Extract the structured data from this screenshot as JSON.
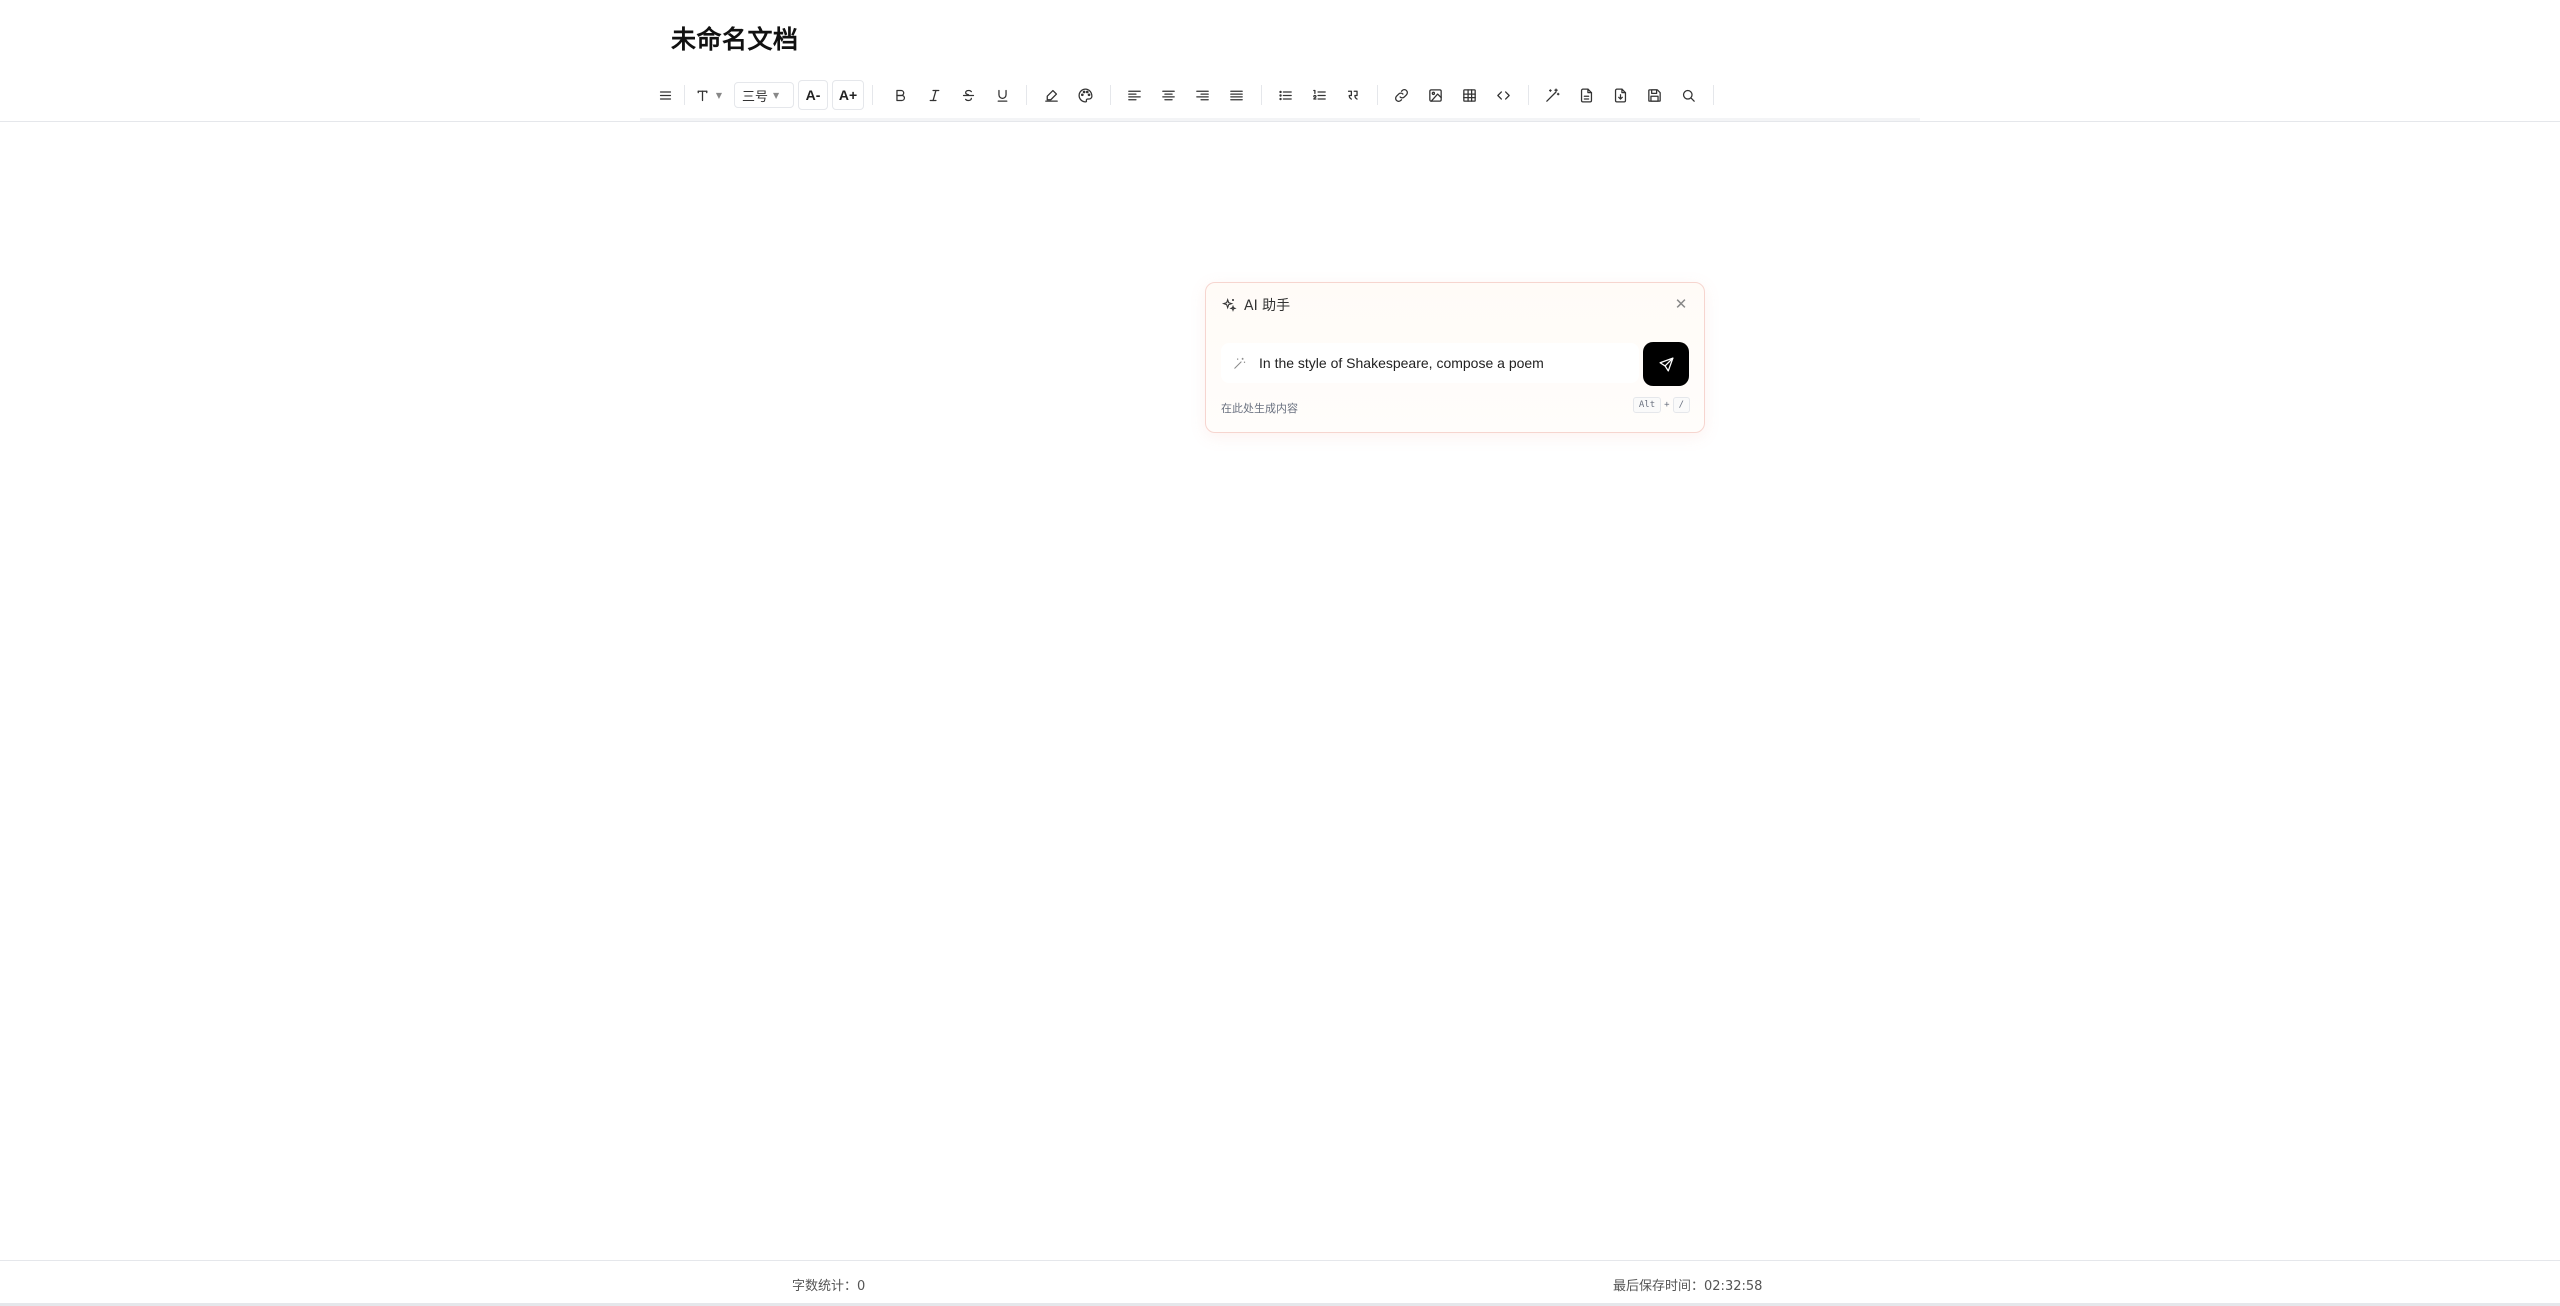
{
  "document": {
    "title": "未命名文档"
  },
  "toolbar": {
    "font_size_value": "三号",
    "decrease_font_label": "A-",
    "increase_font_label": "A+",
    "buttons": [
      "menu-icon",
      "text-style-icon",
      "font-size-select",
      "decrease-font-icon",
      "increase-font-icon",
      "bold-icon",
      "italic-icon",
      "strikethrough-icon",
      "underline-icon",
      "highlight-icon",
      "palette-icon",
      "align-left-icon",
      "align-center-icon",
      "align-right-icon",
      "align-justify-icon",
      "bullet-list-icon",
      "ordered-list-icon",
      "quote-icon",
      "link-icon",
      "image-icon",
      "table-icon",
      "code-icon",
      "ai-magic-icon",
      "file-icon",
      "export-file-icon",
      "save-icon",
      "search-icon"
    ]
  },
  "ai_panel": {
    "title": "AI 助手",
    "input_value": "In the style of Shakespeare, compose a poem",
    "hint": "在此处生成内容",
    "shortcut": [
      "Alt",
      "+",
      "/"
    ]
  },
  "status": {
    "word_count_label": "字数统计：",
    "word_count_value": "0",
    "last_saved_label": "最后保存时间：",
    "last_saved_value": "02:32:58"
  }
}
